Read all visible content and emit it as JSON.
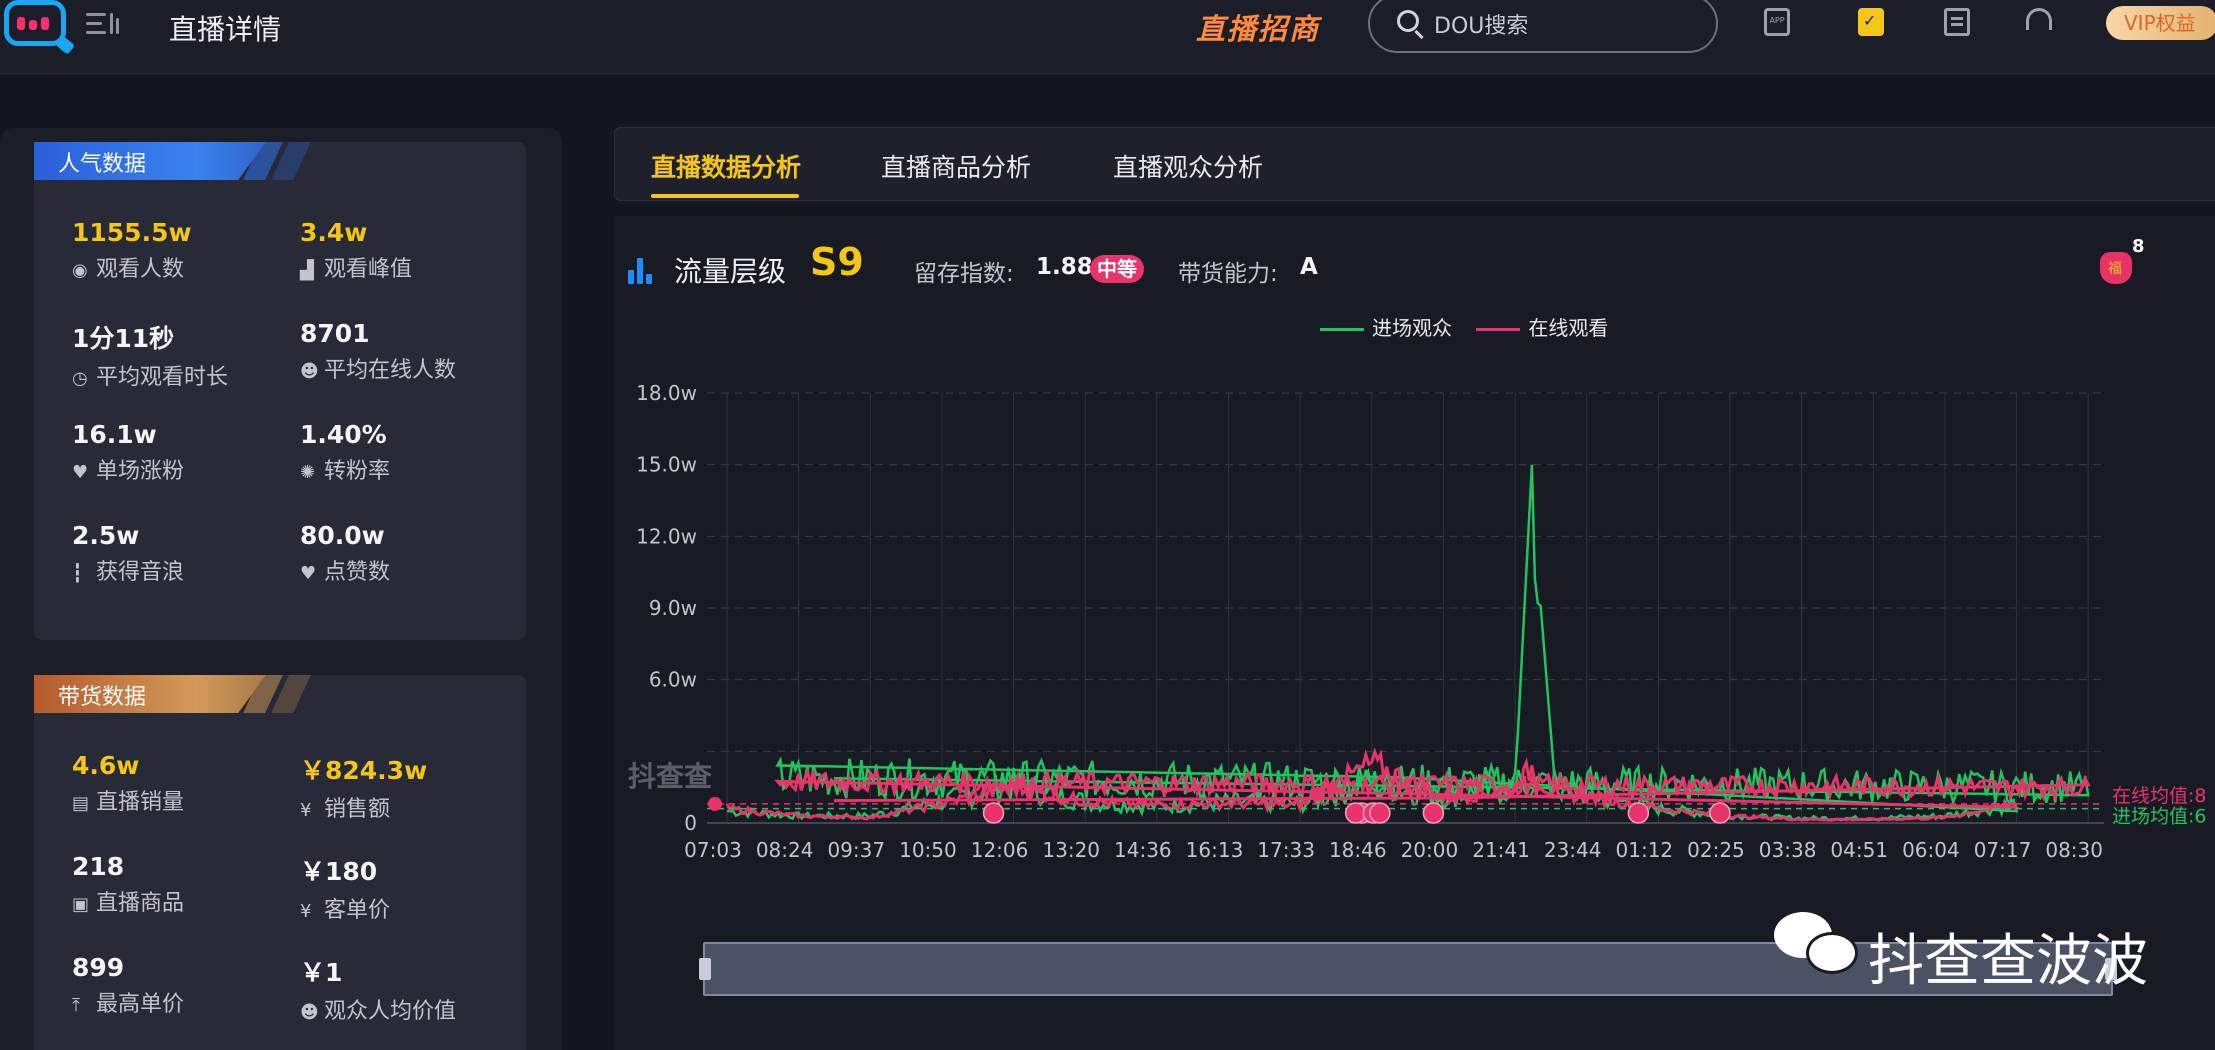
{
  "header": {
    "title": "直播详情",
    "promo": "直播招商",
    "search_placeholder": "DOU搜索",
    "app_icon_text": "APP",
    "vip": "VIP权益",
    "icons": [
      "logo-icon",
      "menu-icon",
      "search-icon",
      "app-icon",
      "calendar-check-icon",
      "document-icon",
      "headphones-icon"
    ]
  },
  "popularity": {
    "title": "人气数据",
    "stats": [
      {
        "value": "1155.5w",
        "label": "观看人数",
        "icon": "eye-icon",
        "highlight": true
      },
      {
        "value": "3.4w",
        "label": "观看峰值",
        "icon": "bars-icon",
        "highlight": true
      },
      {
        "value": "1分11秒",
        "label": "平均观看时长",
        "icon": "clock-icon",
        "highlight": false
      },
      {
        "value": "8701",
        "label": "平均在线人数",
        "icon": "user-online-icon",
        "highlight": false
      },
      {
        "value": "16.1w",
        "label": "单场涨粉",
        "icon": "heart-plus-icon",
        "highlight": false
      },
      {
        "value": "1.40%",
        "label": "转粉率",
        "icon": "percent-icon",
        "highlight": false
      },
      {
        "value": "2.5w",
        "label": "获得音浪",
        "icon": "soundwave-icon",
        "highlight": false
      },
      {
        "value": "80.0w",
        "label": "点赞数",
        "icon": "heart-icon",
        "highlight": false
      }
    ]
  },
  "sales": {
    "title": "带货数据",
    "stats": [
      {
        "value": "4.6w",
        "label": "直播销量",
        "icon": "stack-icon",
        "highlight": true
      },
      {
        "value": "￥824.3w",
        "label": "销售额",
        "icon": "yen-circle-icon",
        "highlight": true
      },
      {
        "value": "218",
        "label": "直播商品",
        "icon": "bag-icon",
        "highlight": false
      },
      {
        "value": "￥180",
        "label": "客单价",
        "icon": "yen-icon",
        "highlight": false
      },
      {
        "value": "899",
        "label": "最高单价",
        "icon": "arrow-up-icon",
        "highlight": false
      },
      {
        "value": "￥1",
        "label": "观众人均价值",
        "icon": "user-yen-icon",
        "highlight": false
      }
    ]
  },
  "tabs": [
    {
      "label": "直播数据分析",
      "active": true
    },
    {
      "label": "直播商品分析",
      "active": false
    },
    {
      "label": "直播观众分析",
      "active": false
    }
  ],
  "flow": {
    "label": "流量层级",
    "level": "S9",
    "retention_label": "留存指数:",
    "retention_value": "1.88",
    "retention_badge": "中等",
    "selling_label": "带货能力:",
    "selling_value": "A",
    "gift_count": "8"
  },
  "watermark": {
    "small": "抖查查",
    "large": "抖查查波波"
  },
  "chart_data": {
    "type": "line",
    "legend": [
      "进场观众",
      "在线观看"
    ],
    "colors": {
      "进场观众": "#21c55d",
      "在线观看": "#e8336b"
    },
    "yticks": [
      "18.0w",
      "15.0w",
      "12.0w",
      "9.0w",
      "6.0w",
      "",
      "0"
    ],
    "ylim": [
      0,
      18
    ],
    "yunit": "w",
    "xticks": [
      "07:03",
      "08:24",
      "09:37",
      "10:50",
      "12:06",
      "13:20",
      "14:36",
      "16:13",
      "17:33",
      "18:46",
      "20:00",
      "21:41",
      "23:44",
      "01:12",
      "02:25",
      "03:38",
      "04:51",
      "06:04",
      "07:17",
      "08:30"
    ],
    "mean_labels": [
      "在线均值:8",
      "进场均值:6"
    ],
    "series": [
      {
        "name": "进场观众",
        "x": [
          "07:03",
          "08:24",
          "09:37",
          "10:50",
          "12:06",
          "13:20",
          "14:36",
          "16:13",
          "17:33",
          "18:46",
          "20:00",
          "21:41",
          "22:10",
          "22:20",
          "22:50",
          "23:44",
          "01:12",
          "02:25",
          "03:38",
          "04:51",
          "06:04",
          "07:17",
          "08:00",
          "08:30",
          "09:00"
        ],
        "values": [
          0.5,
          0.3,
          0.3,
          0.9,
          1.6,
          0.9,
          0.7,
          0.9,
          0.8,
          1.7,
          1.1,
          1.5,
          15.0,
          10.6,
          1.5,
          1.2,
          0.6,
          0.3,
          0.2,
          0.2,
          0.3,
          0.8,
          1.9,
          1.5,
          1.3
        ]
      },
      {
        "name": "在线观看",
        "x": [
          "07:03",
          "08:24",
          "09:37",
          "10:50",
          "12:06",
          "13:20",
          "14:36",
          "16:13",
          "17:33",
          "18:46",
          "20:00",
          "21:41",
          "22:10",
          "22:20",
          "22:50",
          "23:44",
          "01:12",
          "02:25",
          "03:38",
          "04:51",
          "06:04",
          "07:17",
          "08:00",
          "08:30",
          "09:00"
        ],
        "values": [
          0.8,
          0.4,
          0.3,
          1.1,
          2.0,
          1.2,
          1.0,
          1.1,
          1.0,
          3.3,
          1.4,
          1.9,
          3.1,
          2.4,
          1.7,
          1.5,
          0.8,
          0.4,
          0.2,
          0.2,
          0.3,
          1.1,
          2.3,
          2.0,
          1.7
        ]
      }
    ]
  }
}
